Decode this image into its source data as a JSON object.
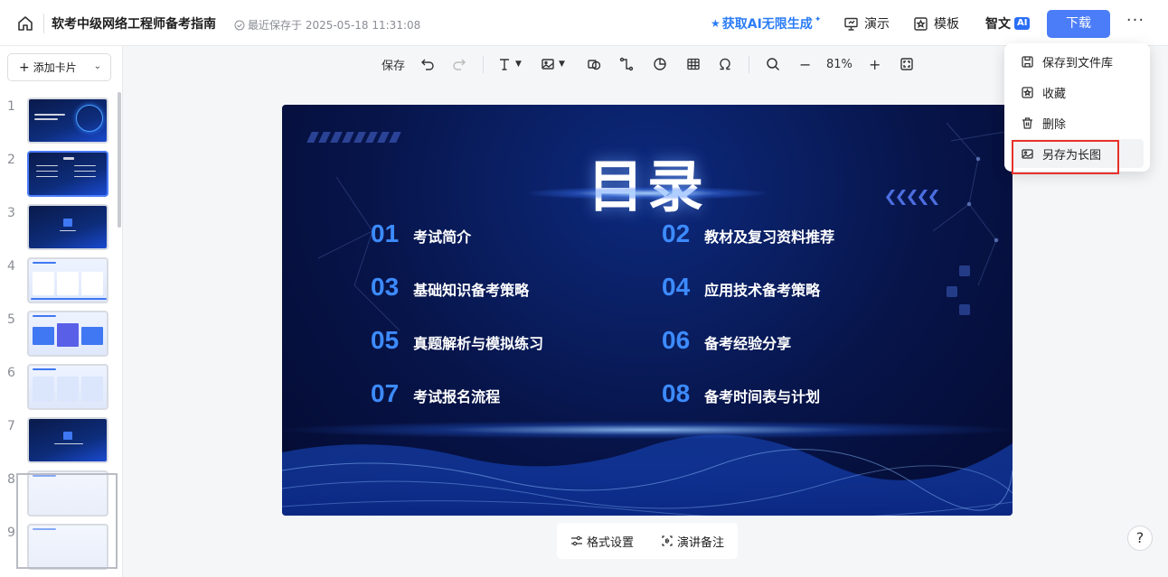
{
  "header": {
    "doc_title": "软考中级网络工程师备考指南",
    "save_status": "最近保存于 2025-05-18 11:31:08",
    "ai_promo": "获取AI无限生成",
    "present_label": "演示",
    "template_label": "模板",
    "zhiwen_label": "智文",
    "ai_badge": "AI",
    "download_label": "下载",
    "more_label": "···"
  },
  "sidebar": {
    "add_card_label": "添加卡片",
    "thumbnails": [
      {
        "num": "1",
        "style": "dark"
      },
      {
        "num": "2",
        "style": "dark",
        "active": true
      },
      {
        "num": "3",
        "style": "dark"
      },
      {
        "num": "4",
        "style": "light"
      },
      {
        "num": "5",
        "style": "light"
      },
      {
        "num": "6",
        "style": "light"
      },
      {
        "num": "7",
        "style": "dark"
      },
      {
        "num": "8",
        "style": "faint"
      },
      {
        "num": "9",
        "style": "faint"
      }
    ]
  },
  "toolbar": {
    "save_label": "保存",
    "zoom_value": "81%",
    "zoom_out": "−",
    "zoom_in": "+"
  },
  "slide": {
    "title": "目录",
    "items": [
      {
        "num": "01",
        "text": "考试简介"
      },
      {
        "num": "02",
        "text": "教材及复习资料推荐"
      },
      {
        "num": "03",
        "text": "基础知识备考策略"
      },
      {
        "num": "04",
        "text": "应用技术备考策略"
      },
      {
        "num": "05",
        "text": "真题解析与模拟练习"
      },
      {
        "num": "06",
        "text": "备考经验分享"
      },
      {
        "num": "07",
        "text": "考试报名流程"
      },
      {
        "num": "08",
        "text": "备考时间表与计划"
      }
    ]
  },
  "bottom_bar": {
    "format_label": "格式设置",
    "notes_label": "演讲备注",
    "help_label": "?"
  },
  "menu": {
    "items": [
      {
        "label": "保存到文件库",
        "icon": "save-icon"
      },
      {
        "label": "收藏",
        "icon": "star-icon"
      },
      {
        "label": "删除",
        "icon": "trash-icon"
      },
      {
        "label": "另存为长图",
        "icon": "image-icon",
        "highlighted": true
      }
    ]
  },
  "colors": {
    "accent": "#4c7df8",
    "slide_bg": "#071449",
    "toc_number": "#3d8bff",
    "highlight_border": "#e8302a"
  }
}
